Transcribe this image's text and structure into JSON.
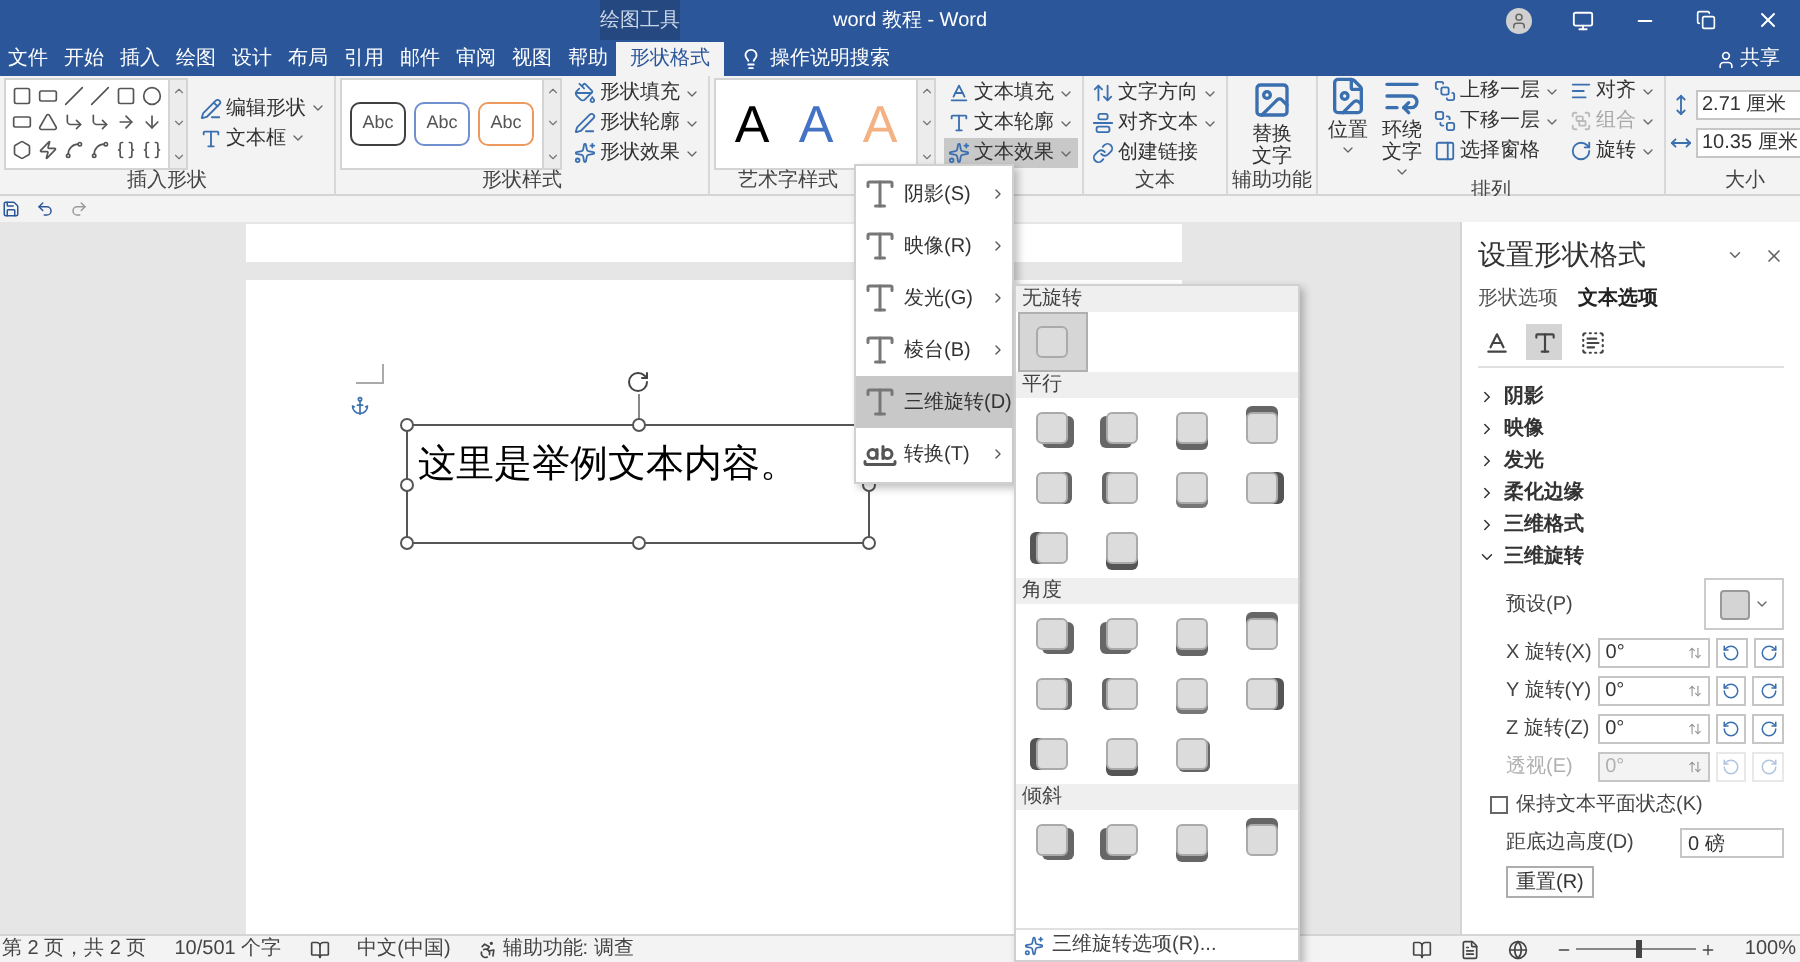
{
  "title_bar": {
    "context_label": "绘图工具",
    "title": "word 教程 - Word"
  },
  "tabs": [
    {
      "label": "文件",
      "selected": false
    },
    {
      "label": "开始",
      "selected": false
    },
    {
      "label": "插入",
      "selected": false
    },
    {
      "label": "绘图",
      "selected": false
    },
    {
      "label": "设计",
      "selected": false
    },
    {
      "label": "布局",
      "selected": false
    },
    {
      "label": "引用",
      "selected": false
    },
    {
      "label": "邮件",
      "selected": false
    },
    {
      "label": "审阅",
      "selected": false
    },
    {
      "label": "视图",
      "selected": false
    },
    {
      "label": "帮助",
      "selected": false
    },
    {
      "label": "形状格式",
      "selected": true
    }
  ],
  "tell_me": "操作说明搜索",
  "share": "共享",
  "ribbon": {
    "groups": [
      {
        "kind": "insert_shapes",
        "label": "插入形状",
        "buttons": [
          {
            "label": "编辑形状",
            "dropdown": true
          },
          {
            "label": "文本框",
            "dropdown": true
          }
        ]
      },
      {
        "kind": "styles",
        "label": "形状样式",
        "samples": [
          {
            "text": "Abc",
            "color": "#404040"
          },
          {
            "text": "Abc",
            "color": "#6f8fcf"
          },
          {
            "text": "Abc",
            "color": "#ed9a5e"
          }
        ],
        "buttons": [
          {
            "label": "形状填充",
            "dropdown": true
          },
          {
            "label": "形状轮廓",
            "dropdown": true
          },
          {
            "label": "形状效果",
            "dropdown": true
          }
        ]
      },
      {
        "kind": "wordart",
        "label": "艺术字样式",
        "samples": [
          {
            "text": "A",
            "color": "#000000"
          },
          {
            "text": "A",
            "color": "#4472c4"
          },
          {
            "text": "A",
            "color": "#f4b183"
          }
        ],
        "buttons": [
          {
            "label": "文本填充",
            "dropdown": true,
            "pressed": false
          },
          {
            "label": "文本轮廓",
            "dropdown": true,
            "pressed": false
          },
          {
            "label": "文本效果",
            "dropdown": true,
            "pressed": true
          }
        ]
      },
      {
        "kind": "small_buttons",
        "label": "文本",
        "buttons": [
          {
            "label": "文字方向",
            "dropdown": true
          },
          {
            "label": "对齐文本",
            "dropdown": true
          },
          {
            "label": "创建链接",
            "dropdown": false
          }
        ]
      },
      {
        "kind": "large_buttons",
        "label": "辅助功能",
        "buttons": [
          {
            "label": "替换文字",
            "dropdown": false
          }
        ]
      },
      {
        "kind": "arrange",
        "label": "排列",
        "large": [
          {
            "label": "位置",
            "dropdown": true
          },
          {
            "label": "环绕文字",
            "dropdown": true
          }
        ],
        "buttons": [
          {
            "label": "上移一层",
            "dropdown": true,
            "disabled": false
          },
          {
            "label": "下移一层",
            "dropdown": true,
            "disabled": false
          },
          {
            "label": "选择窗格",
            "dropdown": false,
            "disabled": false
          },
          {
            "label": "对齐",
            "dropdown": true,
            "disabled": false
          },
          {
            "label": "组合",
            "dropdown": true,
            "disabled": true
          },
          {
            "label": "旋转",
            "dropdown": true,
            "disabled": false
          }
        ]
      },
      {
        "kind": "size",
        "label": "大小",
        "fields": [
          {
            "value": "2.71 厘米"
          },
          {
            "value": "10.35 厘米"
          }
        ]
      }
    ]
  },
  "document": {
    "text": "这里是举例文本内容。"
  },
  "text_effects_menu": {
    "items": [
      {
        "label": "阴影(S)",
        "selected": false
      },
      {
        "label": "映像(R)",
        "selected": false
      },
      {
        "label": "发光(G)",
        "selected": false
      },
      {
        "label": "棱台(B)",
        "selected": false
      },
      {
        "label": "三维旋转(D)",
        "selected": true
      },
      {
        "label": "转换(T)",
        "selected": false
      }
    ]
  },
  "rotation_gallery": {
    "sections": [
      {
        "title": "无旋转",
        "tiles": [
          {
            "selected": true
          }
        ]
      },
      {
        "title": "平行",
        "tiles": [
          {
            "selected": false
          },
          {
            "selected": false
          },
          {
            "selected": false
          },
          {
            "selected": false
          },
          {
            "selected": false
          },
          {
            "selected": false
          },
          {
            "selected": false
          },
          {
            "selected": false
          },
          {
            "selected": false
          },
          {
            "selected": false
          }
        ]
      },
      {
        "title": "角度",
        "tiles": [
          {
            "selected": false
          },
          {
            "selected": false
          },
          {
            "selected": false
          },
          {
            "selected": false
          },
          {
            "selected": false
          },
          {
            "selected": false
          },
          {
            "selected": false
          },
          {
            "selected": false
          },
          {
            "selected": false
          },
          {
            "selected": false
          },
          {
            "selected": false
          }
        ]
      },
      {
        "title": "倾斜",
        "tiles": [
          {
            "selected": false
          },
          {
            "selected": false
          },
          {
            "selected": false
          },
          {
            "selected": false
          }
        ]
      }
    ],
    "footer": "三维旋转选项(R)..."
  },
  "format_pane": {
    "title": "设置形状格式",
    "tabs": [
      {
        "label": "形状选项",
        "selected": false
      },
      {
        "label": "文本选项",
        "selected": true
      }
    ],
    "icon_tabs": [
      {
        "selected": false
      },
      {
        "selected": true
      },
      {
        "selected": false
      }
    ],
    "sections": [
      {
        "label": "阴影",
        "expanded": false
      },
      {
        "label": "映像",
        "expanded": false
      },
      {
        "label": "发光",
        "expanded": false
      },
      {
        "label": "柔化边缘",
        "expanded": false
      },
      {
        "label": "三维格式",
        "expanded": false
      },
      {
        "label": "三维旋转",
        "expanded": true,
        "fields": [
          {
            "kind": "preset",
            "label": "预设(P)"
          },
          {
            "kind": "spin",
            "label": "X 旋转(X)",
            "value": "0°",
            "disabled": false
          },
          {
            "kind": "spin",
            "label": "Y 旋转(Y)",
            "value": "0°",
            "disabled": false
          },
          {
            "kind": "spin",
            "label": "Z 旋转(Z)",
            "value": "0°",
            "disabled": false
          },
          {
            "kind": "spin",
            "label": "透视(E)",
            "value": "0°",
            "disabled": true
          },
          {
            "kind": "checkbox",
            "label": "保持文本平面状态(K)",
            "checked": false
          },
          {
            "kind": "distance",
            "label": "距底边高度(D)",
            "value": "0 磅"
          },
          {
            "kind": "button",
            "label": "重置(R)"
          }
        ]
      }
    ]
  },
  "status_bar": {
    "page": "第 2 页，共 2 页",
    "words": "10/501 个字",
    "language": "中文(中国)",
    "accessibility": "辅助功能: 调查",
    "zoom": {
      "level": 0.5,
      "reading": "100%"
    }
  }
}
